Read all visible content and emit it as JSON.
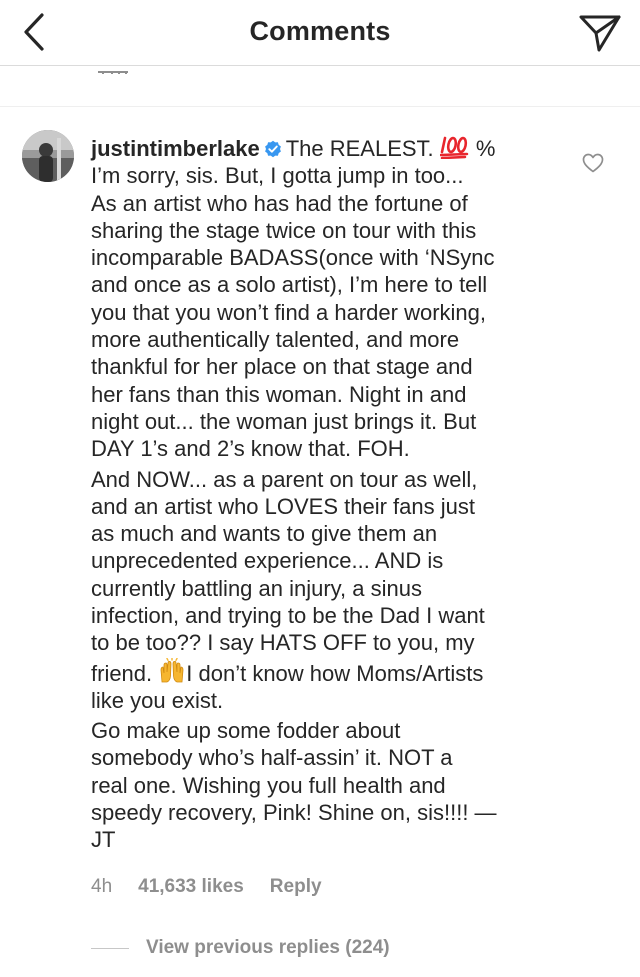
{
  "header": {
    "title": "Comments",
    "back_icon": "chevron-left-icon",
    "send_icon": "paper-plane-icon"
  },
  "comment": {
    "username": "justintimberlake",
    "verified": true,
    "lines": [
      "The REALEST.",
      "%",
      "I’m sorry, sis. But, I gotta jump in too...",
      "As an artist who has had the fortune of",
      "sharing the stage twice on tour with this",
      "incomparable BADASS(once with ‘NSync",
      "and once as a solo artist), I’m here to tell",
      "you that you won’t find a harder working,",
      "more authentically talented, and more",
      "thankful for her place on that stage and",
      "her fans than this woman. Night in and",
      "night out... the woman just brings it. But",
      "DAY 1’s and 2’s know that. FOH.",
      "And NOW... as a parent on tour as well,",
      "and an artist who LOVES their fans just",
      "as much and wants to give them an",
      "unprecedented experience... AND is",
      "currently battling an injury, a sinus",
      "infection, and trying to be the Dad I want",
      "to be too?? I say HATS OFF to you, my",
      "friend.",
      "I don’t know how Moms/Artists",
      "like you exist.",
      "Go make up some fodder about",
      "somebody who’s half-assin’ it. NOT a",
      "real one. Wishing you full health and",
      "speedy recovery, Pink! Shine on, sis!!!! —",
      "JT"
    ],
    "emoji_100": "hundred-points-emoji",
    "emoji_raised_hands": "raising-hands-emoji",
    "time": "4h",
    "likes": "41,633 likes",
    "reply_label": "Reply",
    "heart_icon": "heart-outline-icon"
  },
  "replies": {
    "view_previous": "View previous replies (224)"
  },
  "colors": {
    "text": "#262626",
    "secondary": "#8e8e8e",
    "verified_blue": "#3897f0",
    "divider": "#dbdbdb"
  }
}
